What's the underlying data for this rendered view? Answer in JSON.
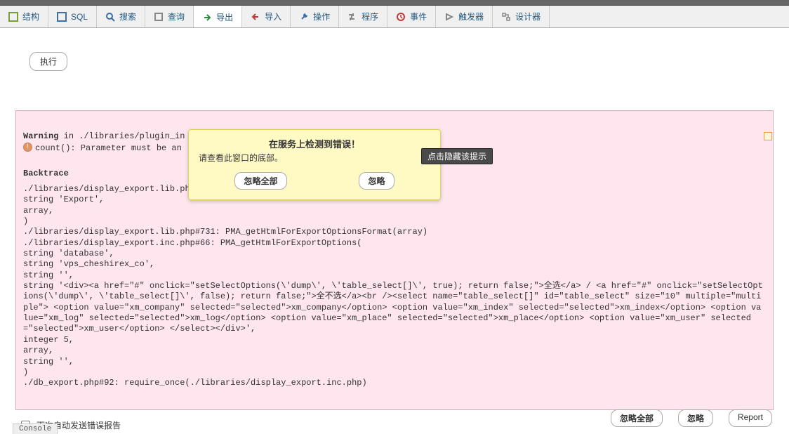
{
  "tabs": {
    "structure": "结构",
    "sql": "SQL",
    "search": "搜索",
    "query": "查询",
    "export": "导出",
    "import": "导入",
    "operations": "操作",
    "routines": "程序",
    "events": "事件",
    "triggers": "触发器",
    "designer": "设计器"
  },
  "buttons": {
    "run": "执行",
    "ignore_all": "忽略全部",
    "ignore": "忽略",
    "report": "Report"
  },
  "modal": {
    "title": "在服务上检测到错误！",
    "sub": "请查看此窗口的底部。",
    "hide_tip": "点击隐藏该提示"
  },
  "autosend": "下次自动发送错误报告",
  "console": "Console",
  "err": {
    "w_label": "Warning",
    "w_tail": " in ./libraries/plugin_in",
    "count_line": "count(): Parameter must be an",
    "bt": "Backtrace",
    "body": "./libraries/display_export.lib.ph\nstring 'Export',\narray,\n)\n./libraries/display_export.lib.php#731: PMA_getHtmlForExportOptionsFormat(array)\n./libraries/display_export.inc.php#66: PMA_getHtmlForExportOptions(\nstring 'database',\nstring 'vps_cheshirex_co',\nstring '',\nstring '<div><a href=\"#\" onclick=\"setSelectOptions(\\'dump\\', \\'table_select[]\\', true); return false;\">全选</a> / <a href=\"#\" onclick=\"setSelectOptions(\\'dump\\', \\'table_select[]\\', false); return false;\">全不选</a><br /><select name=\"table_select[]\" id=\"table_select\" size=\"10\" multiple=\"multiple\"> <option value=\"xm_company\" selected=\"selected\">xm_company</option> <option value=\"xm_index\" selected=\"selected\">xm_index</option> <option value=\"xm_log\" selected=\"selected\">xm_log</option> <option value=\"xm_place\" selected=\"selected\">xm_place</option> <option value=\"xm_user\" selected=\"selected\">xm_user</option> </select></div>',\ninteger 5,\narray,\nstring '',\n)\n./db_export.php#92: require_once(./libraries/display_export.inc.php)"
  }
}
